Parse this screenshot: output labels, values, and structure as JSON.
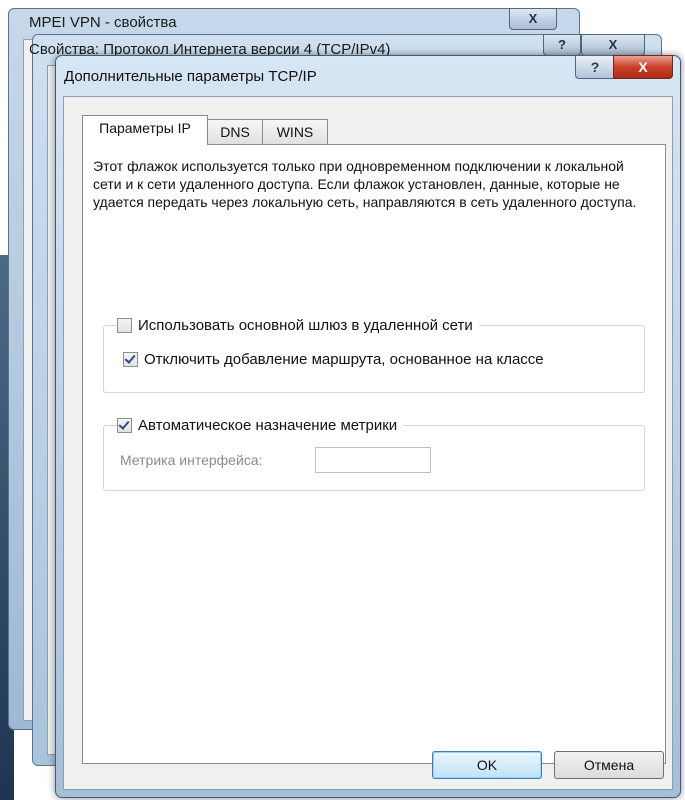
{
  "windows": {
    "back1_title": "MPEI VPN - свойства",
    "back2_title": "Свойства: Протокол Интернета версии 4 (TCP/IPv4)",
    "main_title": "Дополнительные параметры TCP/IP",
    "help_glyph": "?",
    "close_glyph": "X"
  },
  "tabs": [
    {
      "label": "Параметры IP",
      "active": true
    },
    {
      "label": "DNS",
      "active": false
    },
    {
      "label": "WINS",
      "active": false
    }
  ],
  "panel": {
    "description": "Этот флажок используется только при одновременном подключении к локальной сети и к сети удаленного доступа. Если флажок установлен, данные, которые не удается передать через локальную сеть, направляются в сеть удаленного доступа.",
    "use_default_gateway": {
      "label": "Использовать основной шлюз в удаленной сети",
      "checked": false
    },
    "disable_class_route": {
      "label": "Отключить добавление маршрута, основанное на классе",
      "checked": true
    },
    "auto_metric": {
      "label": "Автоматическое назначение метрики",
      "checked": true
    },
    "interface_metric_label": "Метрика интерфейса:",
    "interface_metric_value": ""
  },
  "buttons": {
    "ok": "OK",
    "cancel": "Отмена"
  }
}
